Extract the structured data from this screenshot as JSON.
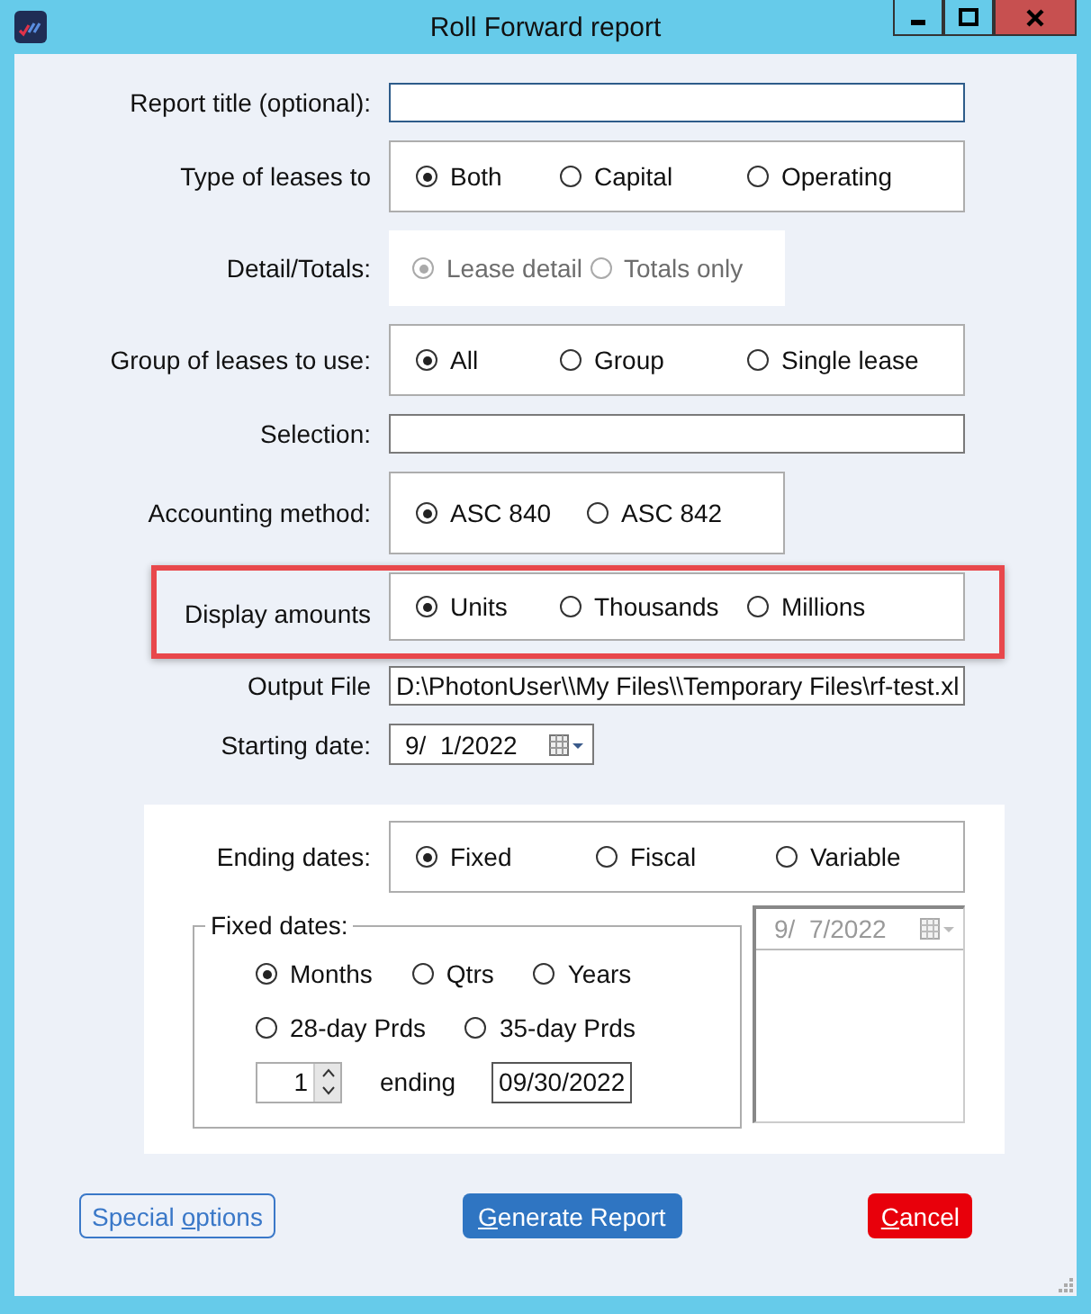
{
  "window": {
    "title": "Roll Forward report"
  },
  "fields": [
    {
      "kind": "input",
      "label": "Report title (optional):"
    },
    {
      "kind": "radios",
      "label": "Type of leases to",
      "disabled": false,
      "wide": true,
      "highlighted": false,
      "options": [
        {
          "label": "Both",
          "selected": true
        },
        {
          "label": "Capital",
          "selected": false
        },
        {
          "label": "Operating",
          "selected": false
        }
      ]
    },
    {
      "kind": "radios",
      "label": "Detail/Totals:",
      "disabled": true,
      "wide": false,
      "highlighted": false,
      "options": [
        {
          "label": "Lease detail",
          "selected": true
        },
        {
          "label": "Totals only",
          "selected": false
        }
      ]
    },
    {
      "kind": "radios",
      "label": "Group of leases to use:",
      "disabled": false,
      "wide": true,
      "highlighted": false,
      "options": [
        {
          "label": "All",
          "selected": true
        },
        {
          "label": "Group",
          "selected": false
        },
        {
          "label": "Single lease",
          "selected": false
        }
      ]
    },
    {
      "kind": "input",
      "label": "Selection:"
    },
    {
      "kind": "radios",
      "label": "Accounting method:",
      "disabled": false,
      "wide": false,
      "highlighted": false,
      "options": [
        {
          "label": "ASC 840",
          "selected": true
        },
        {
          "label": "ASC 842",
          "selected": false
        }
      ]
    },
    {
      "kind": "radios",
      "label": "Display amounts",
      "disabled": false,
      "wide": true,
      "highlighted": true,
      "options": [
        {
          "label": "Units",
          "selected": true
        },
        {
          "label": "Thousands",
          "selected": false
        },
        {
          "label": "Millions",
          "selected": false
        }
      ]
    },
    {
      "kind": "input",
      "label": "Output File",
      "value": "D:\\PhotonUser\\\\My Files\\\\Temporary Files\\rf-test.xl"
    },
    {
      "kind": "date",
      "label": "Starting date:",
      "value": "9/  1/2022"
    }
  ],
  "ending": {
    "label": "Ending dates:",
    "options": [
      {
        "label": "Fixed",
        "selected": true
      },
      {
        "label": "Fiscal",
        "selected": false
      },
      {
        "label": "Variable",
        "selected": false
      }
    ]
  },
  "fixed_dates": {
    "legend": "Fixed dates:",
    "options": [
      {
        "label": "Months",
        "selected": true
      },
      {
        "label": "Qtrs",
        "selected": false
      },
      {
        "label": "Years",
        "selected": false
      },
      {
        "label": "28-day Prds",
        "selected": false
      },
      {
        "label": "35-day Prds",
        "selected": false
      }
    ],
    "count": "1",
    "ending_label": "ending",
    "ending_value": "09/30/2022"
  },
  "variable_date": {
    "value": "9/  7/2022",
    "disabled": true
  },
  "buttons": [
    {
      "kind": "outline",
      "before": "Special ",
      "key": "o",
      "after": "ptions"
    },
    {
      "kind": "primary",
      "key": "G",
      "after": "enerate Report"
    },
    {
      "kind": "danger",
      "key": "C",
      "after": "ancel"
    }
  ]
}
